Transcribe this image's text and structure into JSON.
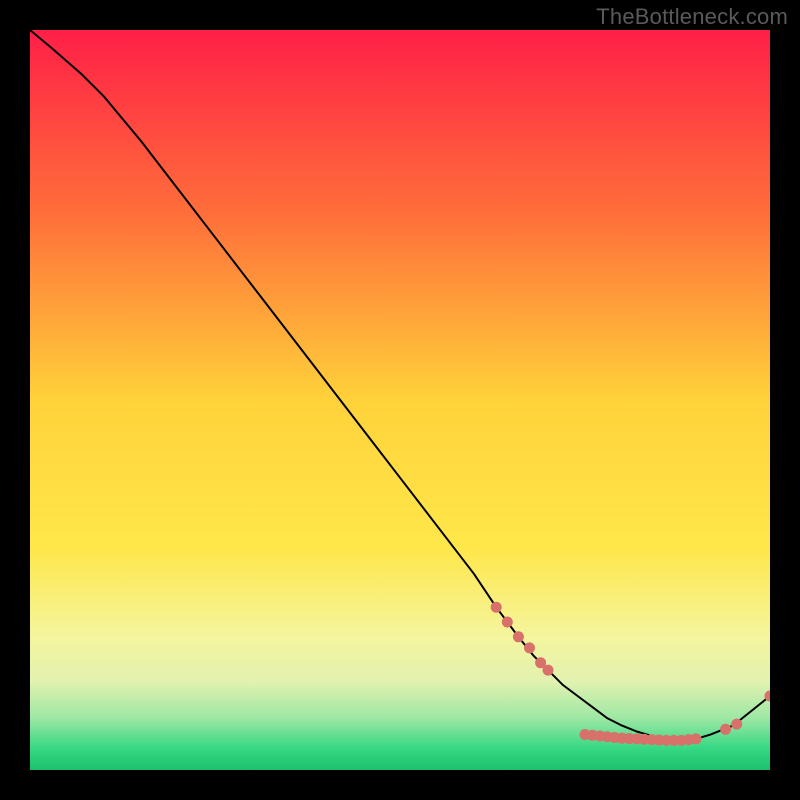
{
  "watermark": "TheBottleneck.com",
  "chart_data": {
    "type": "line",
    "title": "",
    "xlabel": "",
    "ylabel": "",
    "xlim": [
      0,
      100
    ],
    "ylim": [
      0,
      100
    ],
    "grid": false,
    "line_color": "#000000",
    "marker_color": "#d9716b",
    "background_gradient": [
      {
        "offset": 0.0,
        "color": "#ff1f47"
      },
      {
        "offset": 0.25,
        "color": "#ff6f3a"
      },
      {
        "offset": 0.5,
        "color": "#ffd23a"
      },
      {
        "offset": 0.7,
        "color": "#ffe74a"
      },
      {
        "offset": 0.82,
        "color": "#f4f59e"
      },
      {
        "offset": 0.88,
        "color": "#e2f2b0"
      },
      {
        "offset": 0.93,
        "color": "#9de7a4"
      },
      {
        "offset": 0.97,
        "color": "#38d884"
      },
      {
        "offset": 1.0,
        "color": "#1cc06e"
      }
    ],
    "x": [
      0,
      3,
      7,
      10,
      15,
      20,
      25,
      30,
      35,
      40,
      45,
      50,
      55,
      60,
      63,
      66,
      68,
      70,
      72,
      74,
      76,
      78,
      80,
      82,
      84,
      86,
      88,
      90,
      92,
      95,
      100
    ],
    "values": [
      100,
      97.5,
      94,
      91,
      85,
      78.5,
      72,
      65.5,
      59,
      52.5,
      46,
      39.5,
      33,
      26.5,
      22,
      18,
      15.5,
      13.5,
      11.5,
      10,
      8.5,
      7,
      6,
      5.2,
      4.6,
      4.2,
      4,
      4.2,
      4.8,
      6,
      10
    ],
    "marker_points": [
      {
        "x": 63,
        "y": 22
      },
      {
        "x": 64.5,
        "y": 20
      },
      {
        "x": 66,
        "y": 18
      },
      {
        "x": 67.5,
        "y": 16.5
      },
      {
        "x": 69,
        "y": 14.5
      },
      {
        "x": 70,
        "y": 13.5
      },
      {
        "x": 75,
        "y": 4.8
      },
      {
        "x": 76,
        "y": 4.7
      },
      {
        "x": 77,
        "y": 4.6
      },
      {
        "x": 78,
        "y": 4.5
      },
      {
        "x": 79,
        "y": 4.4
      },
      {
        "x": 80,
        "y": 4.3
      },
      {
        "x": 81,
        "y": 4.25
      },
      {
        "x": 82,
        "y": 4.2
      },
      {
        "x": 83,
        "y": 4.15
      },
      {
        "x": 84,
        "y": 4.1
      },
      {
        "x": 85,
        "y": 4.05
      },
      {
        "x": 86,
        "y": 4.0
      },
      {
        "x": 87,
        "y": 4.0
      },
      {
        "x": 88,
        "y": 4.0
      },
      {
        "x": 89,
        "y": 4.1
      },
      {
        "x": 90,
        "y": 4.2
      },
      {
        "x": 94,
        "y": 5.5
      },
      {
        "x": 95.5,
        "y": 6.2
      },
      {
        "x": 100,
        "y": 10
      }
    ]
  }
}
